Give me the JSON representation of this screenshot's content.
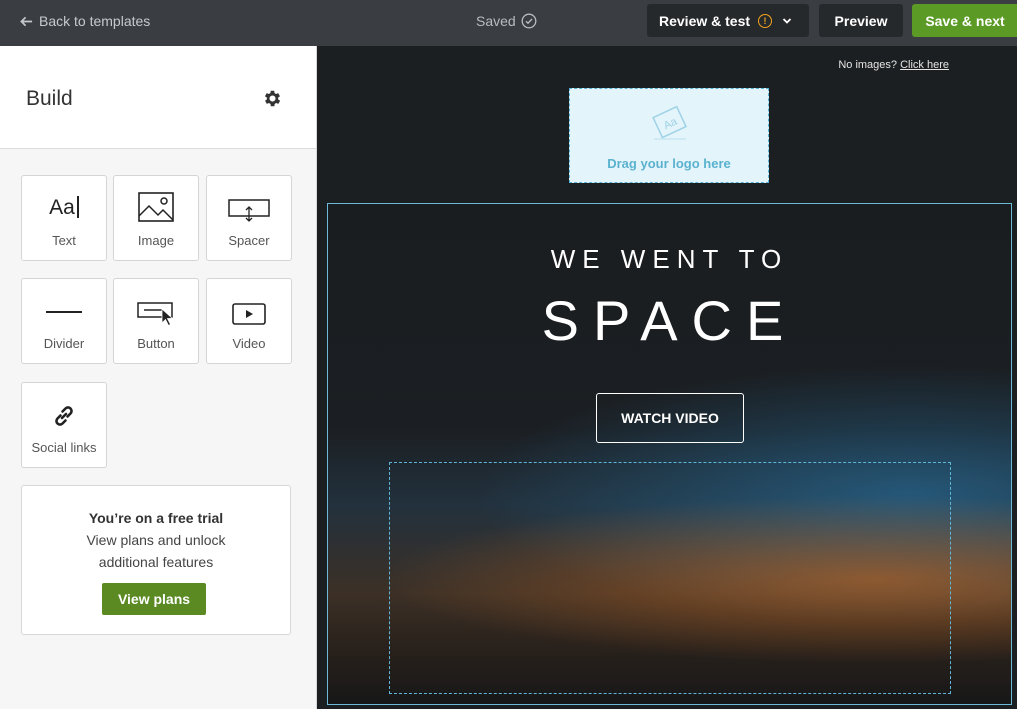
{
  "topbar": {
    "back_label": "Back to templates",
    "saved_label": "Saved",
    "review_label": "Review & test",
    "warning_glyph": "!",
    "preview_label": "Preview",
    "save_next_label": "Save & next"
  },
  "sidebar": {
    "title": "Build",
    "tiles": [
      {
        "label": "Text",
        "icon": "text-icon",
        "glyph": "Aa"
      },
      {
        "label": "Image",
        "icon": "image-icon"
      },
      {
        "label": "Spacer",
        "icon": "spacer-icon"
      },
      {
        "label": "Divider",
        "icon": "divider-icon"
      },
      {
        "label": "Button",
        "icon": "button-icon"
      },
      {
        "label": "Video",
        "icon": "video-icon"
      },
      {
        "label": "Social links",
        "icon": "link-icon"
      }
    ],
    "trial": {
      "title": "You’re on a free trial",
      "line1": "View plans and unlock",
      "line2": "additional features",
      "button": "View plans"
    }
  },
  "canvas": {
    "no_images_text": "No images?",
    "no_images_link": "Click here",
    "logo_drop_text": "Drag your logo here",
    "logo_icon_glyph": "Aa",
    "hero_line1": "WE WENT TO",
    "hero_line2": "SPACE",
    "watch_button": "WATCH VIDEO"
  },
  "colors": {
    "accent_green": "#5b9a24",
    "drop_blue": "#58b3d6",
    "warning": "#f0a21d"
  }
}
